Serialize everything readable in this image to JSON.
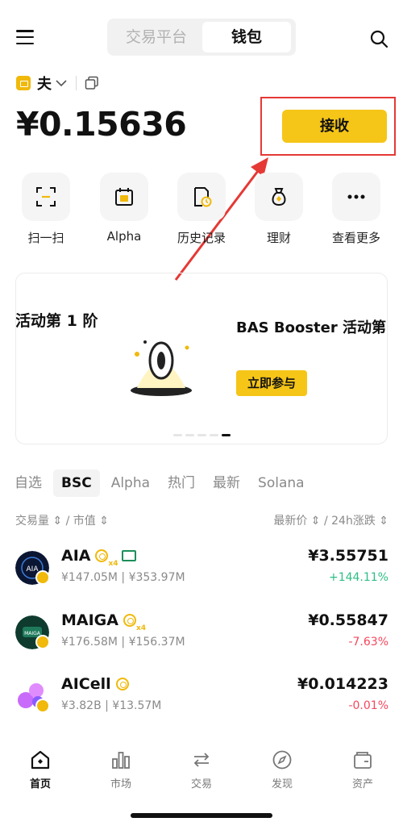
{
  "header": {
    "tabs": [
      {
        "label": "交易平台",
        "active": false
      },
      {
        "label": "钱包",
        "active": true
      }
    ]
  },
  "account": {
    "name": "夫"
  },
  "wallet": {
    "balance": "¥0.15636",
    "receive_label": "接收"
  },
  "quick_actions": [
    {
      "label": "扫一扫",
      "icon": "scan-icon"
    },
    {
      "label": "Alpha",
      "icon": "alpha-calendar-icon"
    },
    {
      "label": "历史记录",
      "icon": "history-icon"
    },
    {
      "label": "理财",
      "icon": "earn-bag-icon"
    },
    {
      "label": "查看更多",
      "icon": "more-icon"
    }
  ],
  "banner": {
    "left_text": "活动第 1 阶",
    "right_title": "BAS Booster 活动第",
    "cta": "立即参与"
  },
  "market_tabs": [
    {
      "label": "自选",
      "active": false
    },
    {
      "label": "BSC",
      "active": true
    },
    {
      "label": "Alpha",
      "active": false
    },
    {
      "label": "热门",
      "active": false
    },
    {
      "label": "最新",
      "active": false
    },
    {
      "label": "Solana",
      "active": false
    }
  ],
  "sort": {
    "left": "交易量 ⇕ / 市值 ⇕",
    "right": "最新价 ⇕ / 24h涨跌 ⇕"
  },
  "tokens": [
    {
      "name": "AIA",
      "sub": "¥147.05M | ¥353.97M",
      "price": "¥3.55751",
      "change": "+144.11%",
      "direction": "up",
      "tags": [
        "alpha-x4",
        "green-card"
      ]
    },
    {
      "name": "MAIGA",
      "sub": "¥176.58M | ¥156.37M",
      "price": "¥0.55847",
      "change": "-7.63%",
      "direction": "down",
      "tags": [
        "alpha-x4"
      ]
    },
    {
      "name": "AICell",
      "sub": "¥3.82B | ¥13.57M",
      "price": "¥0.014223",
      "change": "-0.01%",
      "direction": "down",
      "tags": [
        "alpha"
      ]
    }
  ],
  "bottom_nav": [
    {
      "label": "首页",
      "active": true
    },
    {
      "label": "市场",
      "active": false
    },
    {
      "label": "交易",
      "active": false
    },
    {
      "label": "发现",
      "active": false
    },
    {
      "label": "资产",
      "active": false
    }
  ],
  "colors": {
    "accent": "#f5c518",
    "up": "#2ebd85",
    "down": "#f6465d",
    "annotation": "#e53935"
  }
}
